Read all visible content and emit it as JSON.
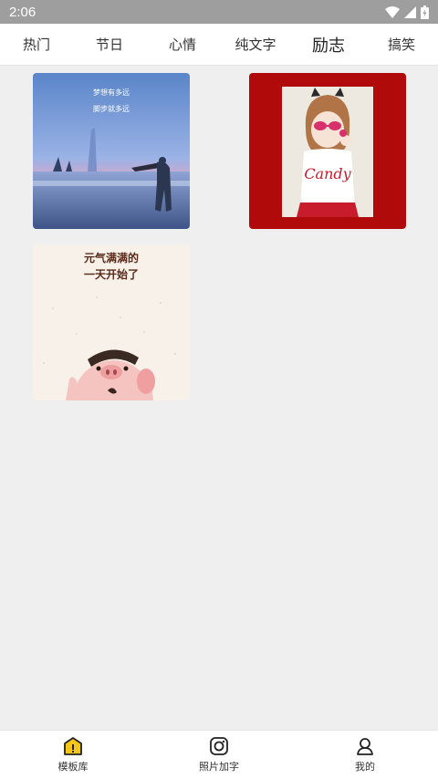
{
  "status_bar": {
    "time": "2:06",
    "icons": [
      "wifi-icon",
      "signal-icon",
      "battery-icon"
    ]
  },
  "tabs": [
    {
      "label": "热门",
      "active": false
    },
    {
      "label": "节日",
      "active": false
    },
    {
      "label": "心情",
      "active": false
    },
    {
      "label": "纯文字",
      "active": false
    },
    {
      "label": "励志",
      "active": true
    },
    {
      "label": "搞笑",
      "active": false
    }
  ],
  "templates": [
    {
      "text_line1": "梦想有多远",
      "text_line2": "脚步就多远"
    },
    {
      "shirt_text": "Candy"
    },
    {
      "text_line1": "元气满满的",
      "text_line2": "一天开始了"
    }
  ],
  "bottom_nav": [
    {
      "label": "模板库",
      "icon": "template-library-icon",
      "active": true
    },
    {
      "label": "照片加字",
      "icon": "camera-icon",
      "active": false
    },
    {
      "label": "我的",
      "icon": "profile-icon",
      "active": false
    }
  ],
  "colors": {
    "status_bar": "#9e9e9e",
    "accent": "#f5c518",
    "card2_bg": "#b00a0a"
  }
}
